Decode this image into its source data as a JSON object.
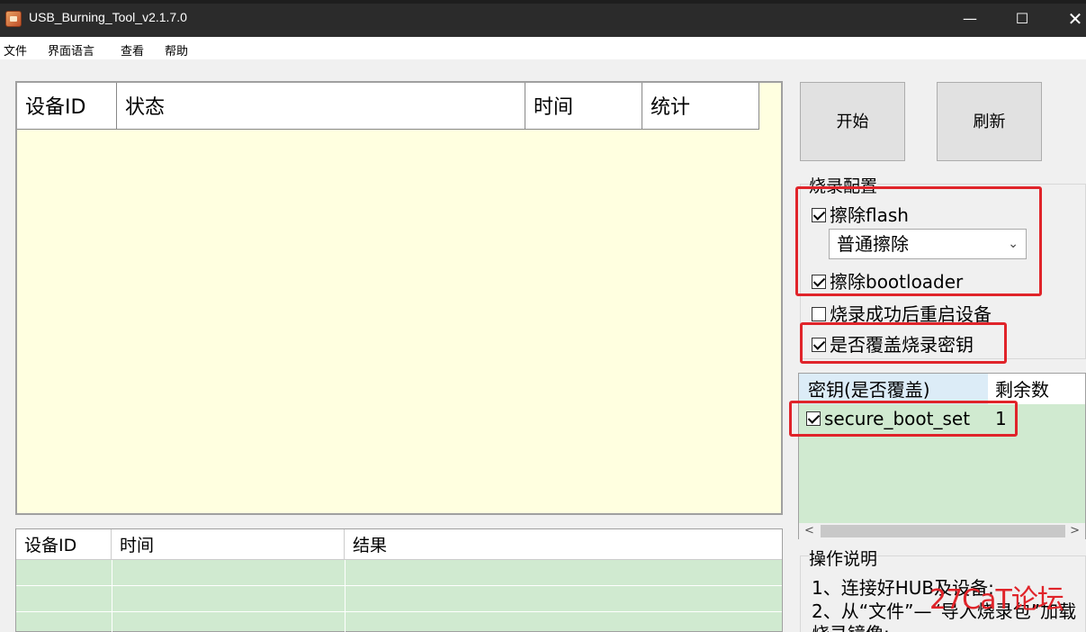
{
  "window": {
    "title": "USB_Burning_Tool_v2.1.7.0",
    "min": "—",
    "max": "☐",
    "close": "✕"
  },
  "menu": [
    "文件",
    "界面语言",
    "查看",
    "帮助"
  ],
  "device_table": {
    "columns": [
      "设备ID",
      "状态",
      "时间",
      "统计"
    ]
  },
  "result_table": {
    "columns": [
      "设备ID",
      "时间",
      "结果"
    ]
  },
  "buttons": {
    "start": "开始",
    "refresh": "刷新"
  },
  "config": {
    "group_label": "烧录配置",
    "erase_flash": {
      "label": "擦除flash",
      "checked": true
    },
    "erase_mode": "普通擦除",
    "erase_bootloader": {
      "label": "擦除bootloader",
      "checked": true
    },
    "reboot_after": {
      "label": "烧录成功后重启设备",
      "checked": false
    },
    "overwrite_key": {
      "label": "是否覆盖烧录密钥",
      "checked": true
    }
  },
  "keys": {
    "columns": [
      "密钥(是否覆盖)",
      "剩余数"
    ],
    "rows": [
      {
        "name": "secure_boot_set",
        "checked": true,
        "remaining": "1"
      }
    ]
  },
  "instructions": {
    "group_label": "操作说明",
    "lines": [
      "1、连接好HUB及设备;",
      "2、从“文件”—“导入烧录包”加载",
      "烧录镜像;"
    ]
  },
  "watermark": "27CaT论坛",
  "colors": {
    "highlight": "#e0242a",
    "device_bg": "#ffffe0",
    "result_bg": "#d0ead0"
  }
}
